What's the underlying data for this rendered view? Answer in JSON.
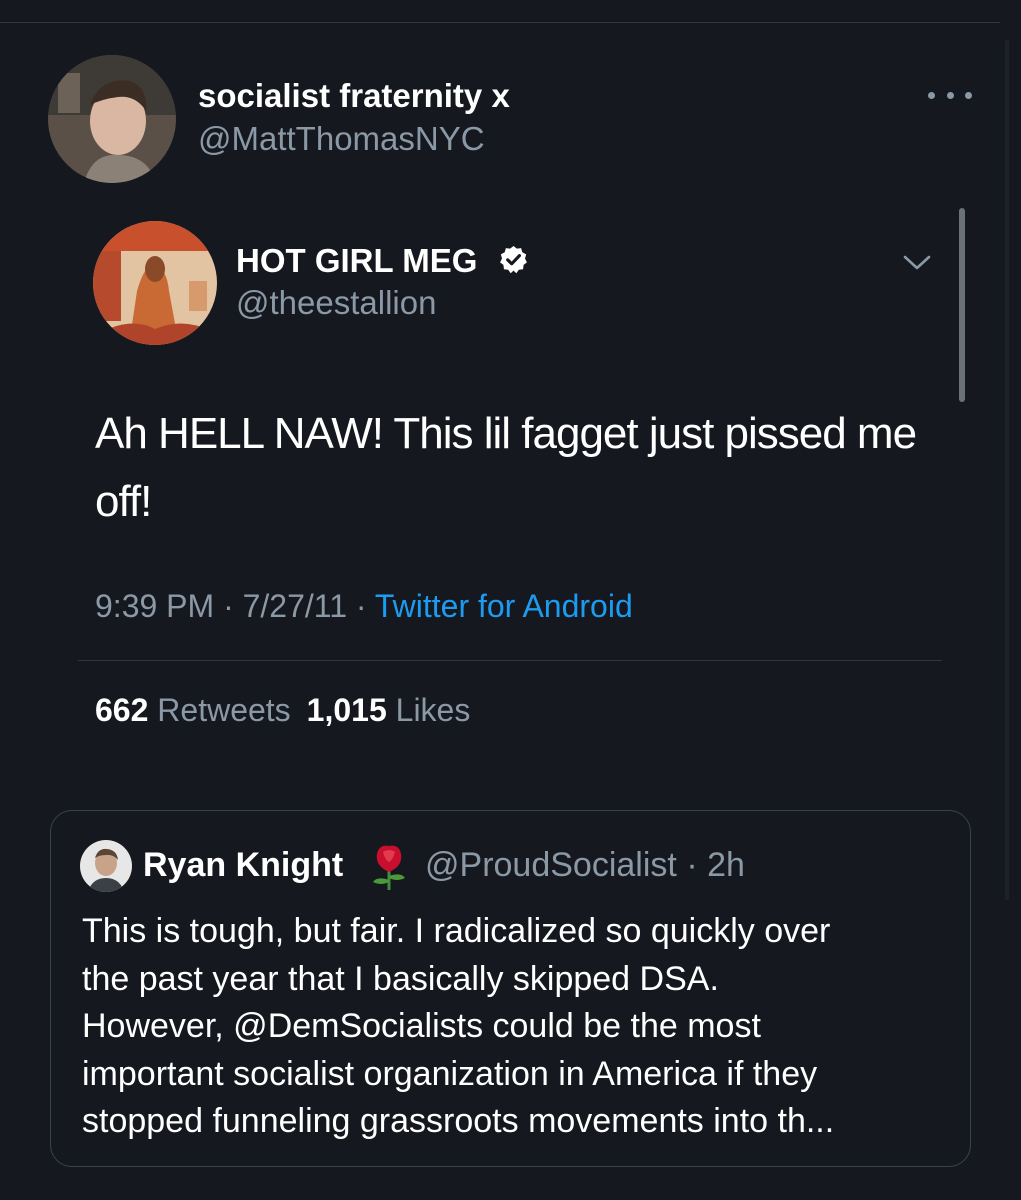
{
  "outer_tweet": {
    "display_name": "socialist fraternity x",
    "handle": "@MattThomasNYC"
  },
  "embedded_tweet": {
    "display_name": "HOT GIRL MEG",
    "handle": "@theestallion",
    "text": "Ah HELL NAW! This lil fagget just pissed me off!",
    "time": "9:39 PM",
    "separator": "·",
    "date": "7/27/11",
    "source": "Twitter for Android",
    "retweets_count": "662",
    "retweets_label": "Retweets",
    "likes_count": "1,015",
    "likes_label": "Likes"
  },
  "quote_card": {
    "display_name": "Ryan Knight",
    "handle": "@ProudSocialist",
    "separator": "·",
    "time_ago": "2h",
    "lines": [
      "This is tough, but fair. I radicalized so quickly over",
      "the past year that I basically skipped DSA.",
      "However, @DemSocialists could be the most",
      "important socialist organization in America if they",
      "stopped funneling grassroots movements into th..."
    ]
  },
  "colors": {
    "background": "#15181f",
    "text_primary": "#ffffff",
    "text_secondary": "#8b98a5",
    "link": "#1d9bf0",
    "border": "#38444d"
  },
  "icons": [
    "more-icon",
    "verified-icon",
    "chevron-down-icon",
    "rose-icon"
  ]
}
